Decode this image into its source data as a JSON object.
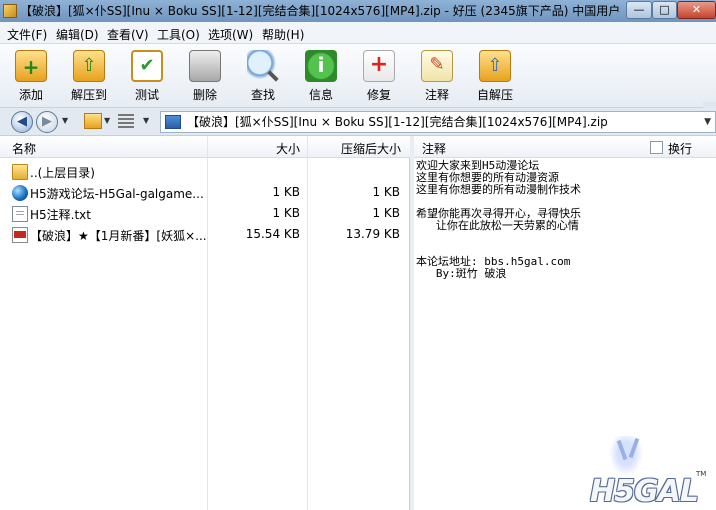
{
  "window": {
    "title": "【破浪】[狐×仆SS][Inu × Boku SS][1-12][完结合集][1024x576][MP4].zip - 好压 (2345旗下产品) 中国用户最...",
    "min": "—",
    "max": "□",
    "close": "✕"
  },
  "menu": {
    "items": [
      "文件(F)",
      "编辑(D)",
      "查看(V)",
      "工具(O)",
      "选项(W)",
      "帮助(H)"
    ]
  },
  "toolbar": {
    "buttons": [
      {
        "label": "添加",
        "icon": "add-icon"
      },
      {
        "label": "解压到",
        "icon": "extract-icon"
      },
      {
        "label": "测试",
        "icon": "test-icon"
      },
      {
        "label": "删除",
        "icon": "delete-icon"
      },
      {
        "label": "查找",
        "icon": "find-icon"
      },
      {
        "label": "信息",
        "icon": "info-icon"
      },
      {
        "label": "修复",
        "icon": "repair-icon"
      },
      {
        "label": "注释",
        "icon": "comment-icon"
      },
      {
        "label": "自解压",
        "icon": "sfx-icon"
      }
    ]
  },
  "address": {
    "path": "【破浪】[狐×仆SS][Inu × Boku SS][1-12][完结合集][1024x576][MP4].zip"
  },
  "filelist": {
    "columns": {
      "name": "名称",
      "size": "大小",
      "compressed": "压缩后大小"
    },
    "rows": [
      {
        "name": "..(上层目录)",
        "size": "",
        "compressed": "",
        "icon": "folder-icon"
      },
      {
        "name": "H5游戏论坛-H5Gal-galgame...",
        "size": "1 KB",
        "compressed": "1 KB",
        "icon": "globe-icon"
      },
      {
        "name": "H5注释.txt",
        "size": "1 KB",
        "compressed": "1 KB",
        "icon": "txt-file-icon"
      },
      {
        "name": "【破浪】★【1月新番】[妖狐×...",
        "size": "15.54 KB",
        "compressed": "13.79 KB",
        "icon": "torrent-file-icon"
      }
    ]
  },
  "comment": {
    "header": "注释",
    "wrap_label": "换行",
    "text": "欢迎大家来到H5动漫论坛\n这里有你想要的所有动漫资源\n这里有你想要的所有动漫制作技术\n\n希望你能再次寻得开心，寻得快乐\n   让你在此放松一天劳累的心情\n\n\n本论坛地址: bbs.h5gal.com\n   By:斑竹 破浪",
    "logo_text": "H5GAL",
    "logo_tm": "TM"
  }
}
